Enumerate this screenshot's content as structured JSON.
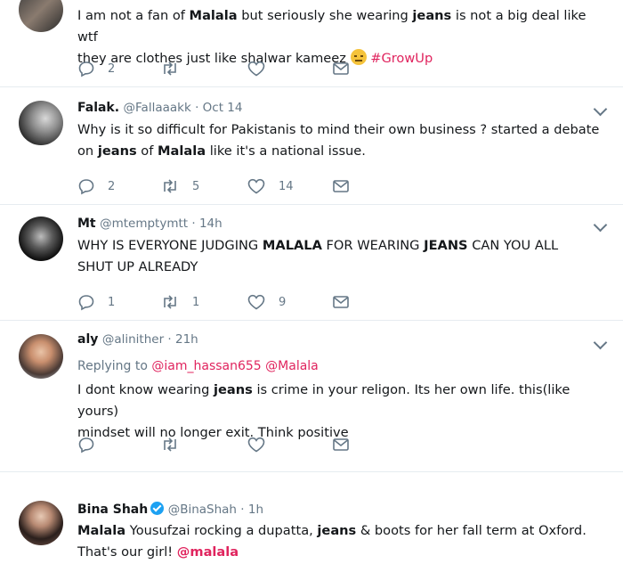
{
  "tweets": [
    {
      "name": "",
      "handle": "",
      "time": "",
      "segments": [
        {
          "t": "I am not a fan of ",
          "b": false
        },
        {
          "t": "Malala",
          "b": true
        },
        {
          "t": " but seriously she wearing ",
          "b": false
        },
        {
          "t": "jeans",
          "b": true
        },
        {
          "t": " is not a big deal like wtf",
          "b": false
        }
      ],
      "line2": "they are clothes just like shalwar kameez",
      "emoji": "expressionless-face",
      "hashtag": "#GrowUp",
      "replies": "2",
      "retweets": "",
      "likes": ""
    },
    {
      "name": "Falak.",
      "handle": "@Fallaaakk",
      "time": "Oct 14",
      "line1": "Why is it so difficult for Pakistanis to mind their own business ? started a debate",
      "line2_segments": [
        {
          "t": "on ",
          "b": false
        },
        {
          "t": "jeans",
          "b": true
        },
        {
          "t": " of ",
          "b": false
        },
        {
          "t": "Malala",
          "b": true
        },
        {
          "t": " like it's a national issue.",
          "b": false
        }
      ],
      "replies": "2",
      "retweets": "5",
      "likes": "14"
    },
    {
      "name": "Mt",
      "handle": "@mtemptymtt",
      "time": "14h",
      "line1_segments": [
        {
          "t": "WHY IS EVERYONE JUDGING ",
          "b": false
        },
        {
          "t": "MALALA",
          "b": true
        },
        {
          "t": " FOR WEARING ",
          "b": false
        },
        {
          "t": "JEANS",
          "b": true
        },
        {
          "t": " CAN YOU ALL",
          "b": false
        }
      ],
      "line2": "SHUT UP ALREADY",
      "replies": "1",
      "retweets": "1",
      "likes": "9"
    },
    {
      "name": "aly",
      "handle": "@alinither",
      "time": "21h",
      "replying_label": "Replying to",
      "reply_mentions": "@iam_hassan655 @Malala",
      "line1_segments": [
        {
          "t": "I dont know wearing ",
          "b": false
        },
        {
          "t": "jeans",
          "b": true
        },
        {
          "t": " is crime in your religon. Its her own life. this(like yours)",
          "b": false
        }
      ],
      "line2": "mindset will no longer exit. Think positive",
      "replies": "",
      "retweets": "",
      "likes": ""
    },
    {
      "name": "Bina Shah",
      "verified": true,
      "handle": "@BinaShah",
      "time": "1h",
      "line1_segments": [
        {
          "t": "Malala",
          "b": true
        },
        {
          "t": " Yousufzai rocking a dupatta, ",
          "b": false
        },
        {
          "t": "jeans",
          "b": true
        },
        {
          "t": " & boots for her fall term at Oxford.",
          "b": false
        }
      ],
      "line2": "That's our girl!",
      "mention": "@malala"
    }
  ],
  "meta_separator": " · ",
  "icons": {
    "reply": "reply-icon",
    "retweet": "retweet-icon",
    "like": "heart-icon",
    "dm": "envelope-icon",
    "more": "chevron-down-icon",
    "verified": "verified-badge-icon"
  },
  "colors": {
    "accent": "#e0245e",
    "muted": "#657786",
    "verified": "#1da1f2"
  }
}
